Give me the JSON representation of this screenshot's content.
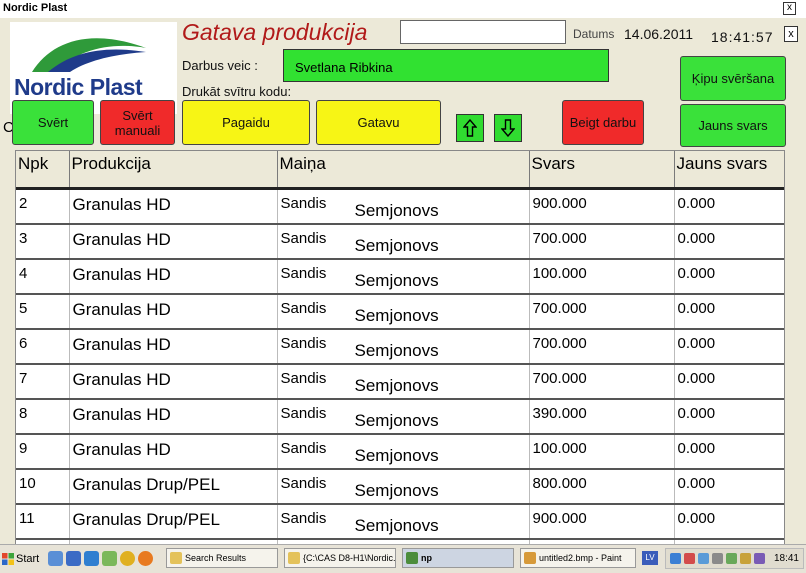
{
  "window": {
    "title": "Nordic Plast",
    "close_label": "x"
  },
  "logo": {
    "brand": "Nordic Plast"
  },
  "header": {
    "title": "Gatava produkcija",
    "date_label": "Datums",
    "date": "14.06.2011",
    "time": "18:41:57",
    "side_control": "x",
    "operator_label": "Darbus veic :",
    "operator": "Svetlana Ribkina",
    "barcode_label": "Drukāt svītru kodu:",
    "stub_text": "C"
  },
  "buttons": {
    "sverit": "Svērt",
    "sverit_manuali": "Svērt manuali",
    "pagaidu": "Pagaidu",
    "gatavu": "Gatavu",
    "beigt_darbu": "Beigt darbu",
    "kipu_sversana": "Ķipu svēršana",
    "jauns_svars": "Jauns svars"
  },
  "colors": {
    "green": "#3ae13a",
    "red": "#f02a2a",
    "yellow": "#f7f515",
    "title_red": "#b11a1a",
    "brand_blue": "#1f3b8a"
  },
  "icons": [
    "up-arrow-icon",
    "down-arrow-icon"
  ],
  "table": {
    "columns": [
      "Npk",
      "Produkcija",
      "Maiņa",
      "Svars",
      "Jauns svars"
    ],
    "rows": [
      {
        "npk": "2",
        "product": "Granulas HD",
        "shift_name": "Sandis",
        "shift_surname": "Semjonovs",
        "weight": "900.000",
        "new_weight": "0.000"
      },
      {
        "npk": "3",
        "product": "Granulas HD",
        "shift_name": "Sandis",
        "shift_surname": "Semjonovs",
        "weight": "700.000",
        "new_weight": "0.000"
      },
      {
        "npk": "4",
        "product": "Granulas HD",
        "shift_name": "Sandis",
        "shift_surname": "Semjonovs",
        "weight": "100.000",
        "new_weight": "0.000"
      },
      {
        "npk": "5",
        "product": "Granulas HD",
        "shift_name": "Sandis",
        "shift_surname": "Semjonovs",
        "weight": "700.000",
        "new_weight": "0.000"
      },
      {
        "npk": "6",
        "product": "Granulas HD",
        "shift_name": "Sandis",
        "shift_surname": "Semjonovs",
        "weight": "700.000",
        "new_weight": "0.000"
      },
      {
        "npk": "7",
        "product": "Granulas HD",
        "shift_name": "Sandis",
        "shift_surname": "Semjonovs",
        "weight": "700.000",
        "new_weight": "0.000"
      },
      {
        "npk": "8",
        "product": "Granulas HD",
        "shift_name": "Sandis",
        "shift_surname": "Semjonovs",
        "weight": "390.000",
        "new_weight": "0.000"
      },
      {
        "npk": "9",
        "product": "Granulas HD",
        "shift_name": "Sandis",
        "shift_surname": "Semjonovs",
        "weight": "100.000",
        "new_weight": "0.000"
      },
      {
        "npk": "10",
        "product": "Granulas Drup/PEL",
        "shift_name": "Sandis",
        "shift_surname": "Semjonovs",
        "weight": "800.000",
        "new_weight": "0.000"
      },
      {
        "npk": "11",
        "product": "Granulas Drup/PEL",
        "shift_name": "Sandis",
        "shift_surname": "Semjonovs",
        "weight": "900.000",
        "new_weight": "0.000"
      },
      {
        "npk": "12",
        "product": "",
        "shift_name": "",
        "shift_surname": "",
        "weight": "",
        "new_weight": ""
      }
    ]
  },
  "taskbar": {
    "start": "Start",
    "tasks": [
      "Search Results",
      "{C:\\CAS D8-H1\\Nordic...",
      "np",
      "untitled2.bmp - Paint"
    ],
    "active_task": 2,
    "lang": "LV",
    "clock": "18:41"
  }
}
